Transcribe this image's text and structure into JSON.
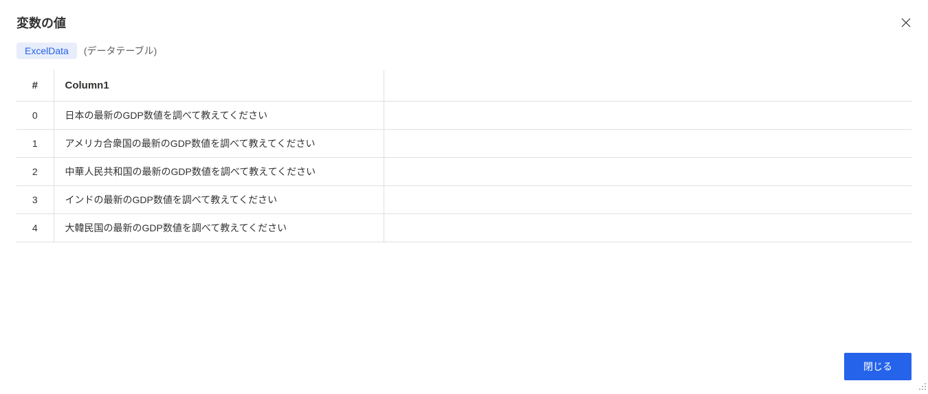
{
  "dialog": {
    "title": "変数の値",
    "close_button_label": "閉じる"
  },
  "variable": {
    "name": "ExcelData",
    "type": "(データテーブル)"
  },
  "table": {
    "headers": {
      "index": "#",
      "column1": "Column1"
    },
    "rows": [
      {
        "index": "0",
        "column1": "日本の最新のGDP数値を調べて教えてください"
      },
      {
        "index": "1",
        "column1": "アメリカ合衆国の最新のGDP数値を調べて教えてください"
      },
      {
        "index": "2",
        "column1": "中華人民共和国の最新のGDP数値を調べて教えてください"
      },
      {
        "index": "3",
        "column1": "インドの最新のGDP数値を調べて教えてください"
      },
      {
        "index": "4",
        "column1": "大韓民国の最新のGDP数値を調べて教えてください"
      }
    ]
  }
}
